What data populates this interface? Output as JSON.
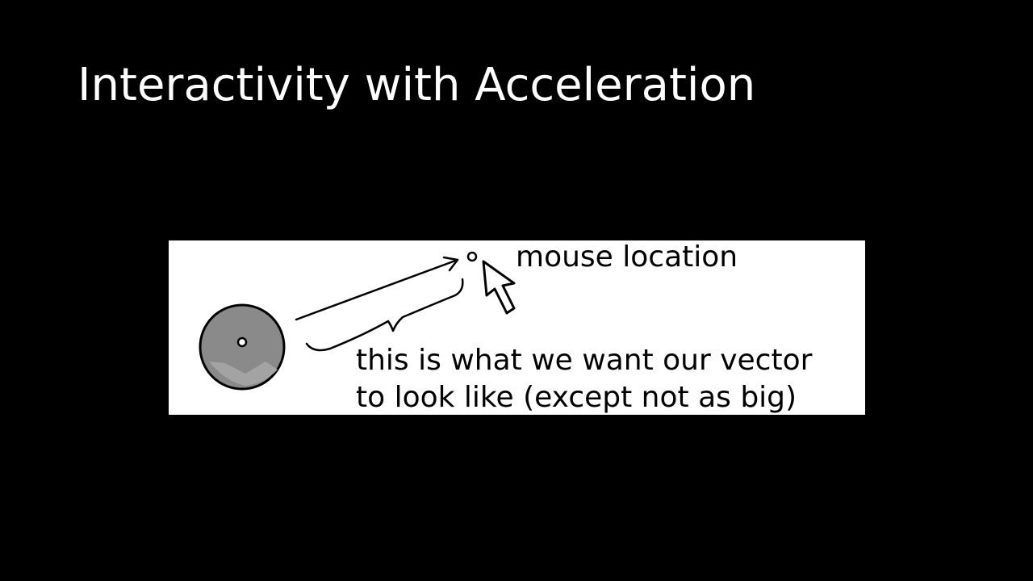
{
  "slide": {
    "title": "Interactivity with Acceleration"
  },
  "figure": {
    "mouse_label": "mouse location",
    "caption_line1": "this is what we want our vector",
    "caption_line2": "to look like (except not as big)",
    "icons": [
      "circle-object-icon",
      "vector-arrow-icon",
      "brace-icon",
      "mouse-point-icon",
      "mouse-cursor-icon"
    ]
  }
}
